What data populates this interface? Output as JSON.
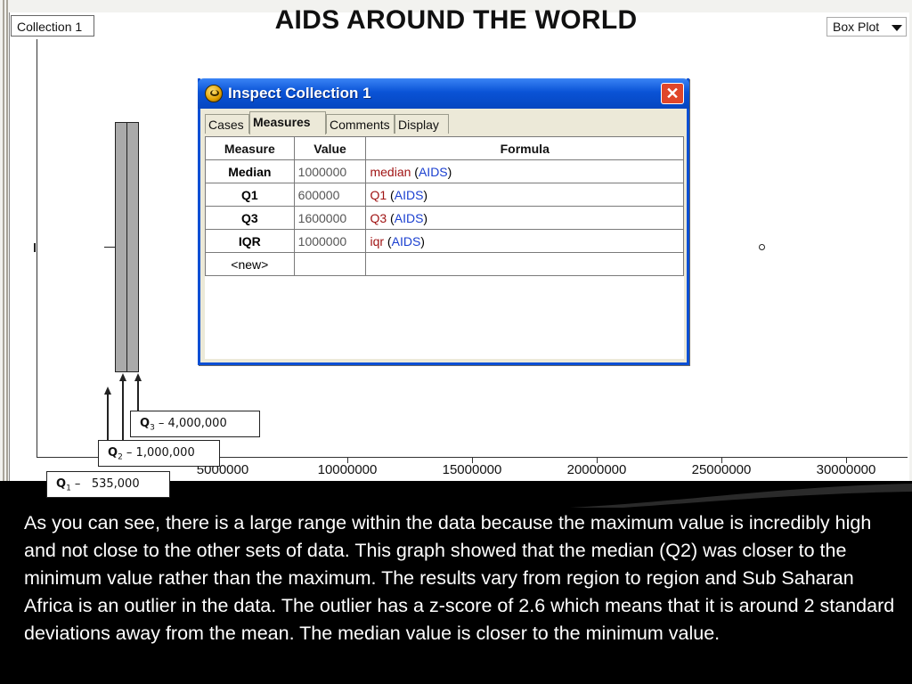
{
  "slide": {
    "title": "AIDS  AROUND THE WORLD",
    "caption": "As you can see, there is a large range within the data because the maximum value is incredibly high and not close to the other sets of data. This graph showed that the median (Q2) was closer to the minimum value rather than the maximum. The results vary from region to region and Sub Saharan Africa is an outlier in the data. The outlier has a z-score of 2.6 which means that it is around 2 standard deviations away from the mean. The median value is closer to the minimum value."
  },
  "toolbar": {
    "collection_select": "Collection 1",
    "plot_type_select": "Box Plot"
  },
  "plot": {
    "x_ticks": [
      "5000000",
      "10000000",
      "15000000",
      "20000000",
      "25000000",
      "30000000"
    ]
  },
  "annotations": {
    "q3": {
      "label": "Q",
      "sub": "3",
      "text": " – 4,000,000"
    },
    "q2": {
      "label": "Q",
      "sub": "2",
      "text": " – 1,000,000"
    },
    "q1": {
      "label": "Q",
      "sub": "1",
      "text": " –   535,000"
    }
  },
  "dialog": {
    "title": "Inspect Collection 1",
    "close_glyph": "✕",
    "tabs": [
      "Cases",
      "Measures",
      "Comments",
      "Display"
    ],
    "active_tab": "Measures",
    "columns": [
      "Measure",
      "Value",
      "Formula"
    ],
    "rows": [
      {
        "measure": "Median",
        "value": "1000000",
        "fn": "median",
        "open": " (",
        "arg": "AIDS",
        "close": ")"
      },
      {
        "measure": "Q1",
        "value": "600000",
        "fn": "Q1",
        "open": " (",
        "arg": "AIDS",
        "close": ")"
      },
      {
        "measure": "Q3",
        "value": "1600000",
        "fn": "Q3",
        "open": " (",
        "arg": "AIDS",
        "close": ")"
      },
      {
        "measure": "IQR",
        "value": "1000000",
        "fn": "iqr",
        "open": " (",
        "arg": "AIDS",
        "close": ")"
      }
    ],
    "new_row_label": "<new>"
  }
}
